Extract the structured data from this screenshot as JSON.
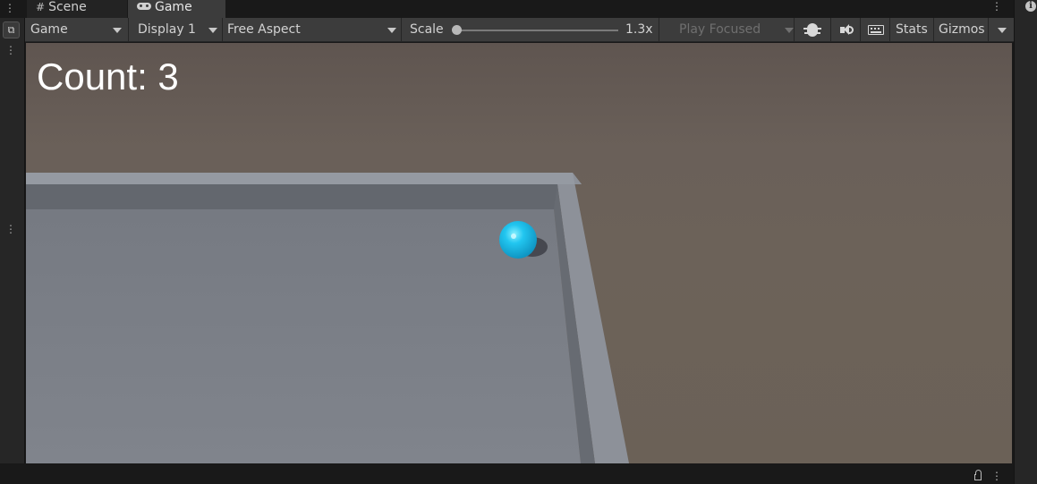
{
  "tabs": [
    {
      "label": "Scene",
      "icon": "grid-icon"
    },
    {
      "label": "Game",
      "icon": "gamepad-icon"
    }
  ],
  "toolbar": {
    "view_label": "Game",
    "display_label": "Display 1",
    "aspect_label": "Free Aspect",
    "scale_label": "Scale",
    "scale_value": "1.3x",
    "play_mode_label": "Play Focused",
    "stats_label": "Stats",
    "gizmos_label": "Gizmos"
  },
  "game": {
    "score_label": "Count:",
    "score_value": "3",
    "ball_color": "#1ec3ee",
    "floor_color": "#7e828a",
    "background_color": "#6a6058"
  }
}
